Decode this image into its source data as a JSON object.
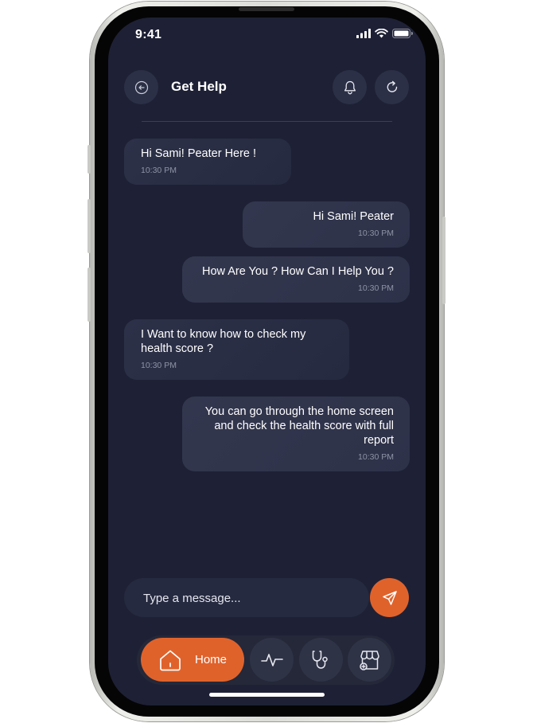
{
  "status_bar": {
    "time": "9:41"
  },
  "header": {
    "title": "Get Help"
  },
  "messages": [
    {
      "direction": "in",
      "text": "Hi Sami! Peater Here !",
      "time": "10:30 PM"
    },
    {
      "direction": "out",
      "text": "Hi Sami! Peater",
      "time": "10:30 PM"
    },
    {
      "direction": "out",
      "text": "How Are You ? How Can I Help You ?",
      "time": "10:30 PM"
    },
    {
      "direction": "in",
      "text": "I Want to know how to check my health score ?",
      "time": "10:30 PM"
    },
    {
      "direction": "out",
      "text": "You can go through the home screen and check the health score with full report",
      "time": "10:30 PM"
    }
  ],
  "composer": {
    "placeholder": "Type a message..."
  },
  "bottom_nav": {
    "home_label": "Home"
  },
  "colors": {
    "accent": "#e0622b",
    "background": "#1e2135",
    "bubble": "#2d3148"
  },
  "icons": [
    "back-arrow-icon",
    "bell-icon",
    "refresh-icon",
    "send-icon",
    "home-icon",
    "activity-icon",
    "stethoscope-icon",
    "store-icon",
    "signal-icon",
    "wifi-icon",
    "battery-icon"
  ]
}
